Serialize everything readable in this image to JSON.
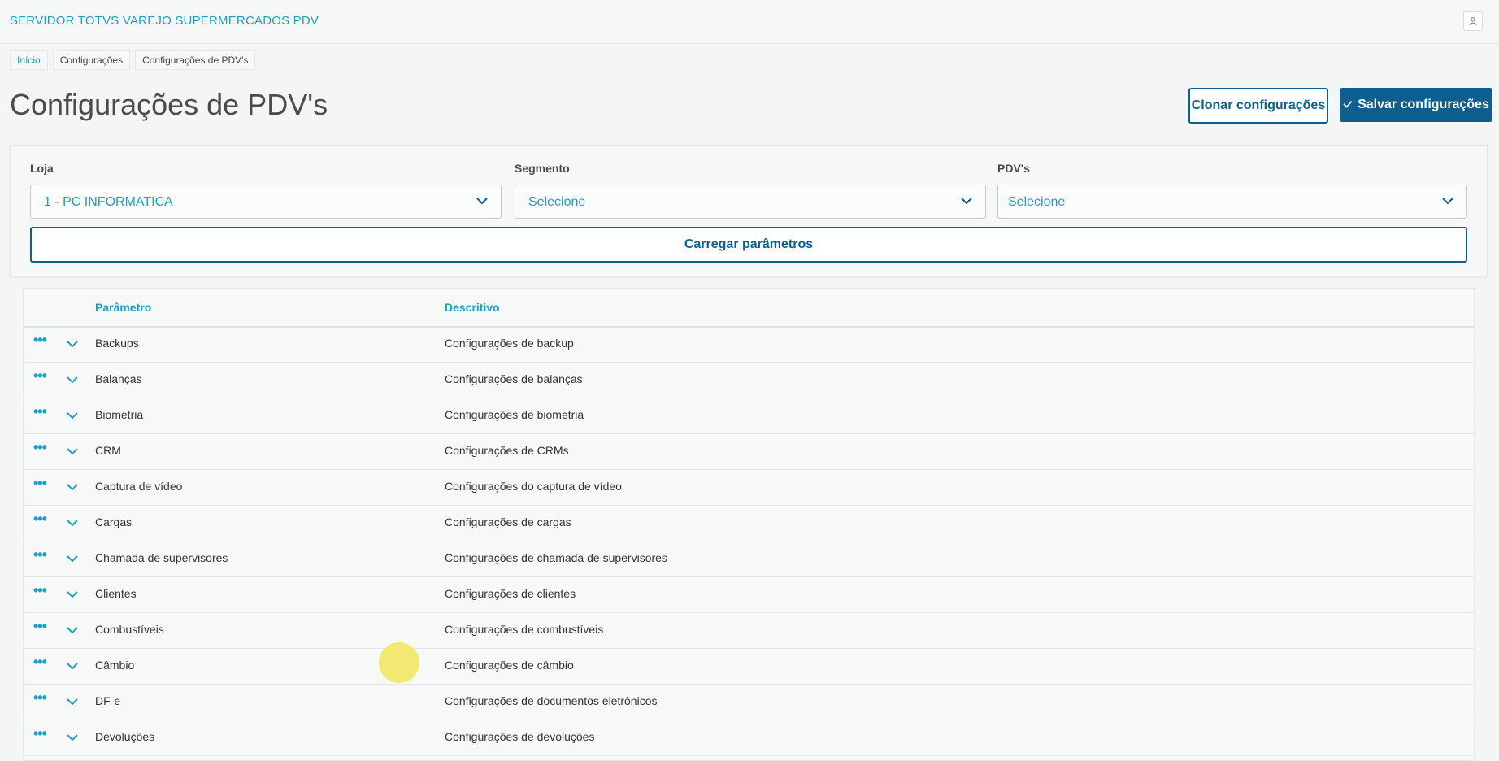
{
  "app": {
    "title": "SERVIDOR TOTVS VAREJO SUPERMERCADOS PDV"
  },
  "breadcrumb": [
    "Início",
    "Configurações",
    "Configurações de PDV's"
  ],
  "page": {
    "title": "Configurações de PDV's"
  },
  "actions": {
    "clone_label": "Clonar configurações",
    "save_label": "Salvar configurações"
  },
  "filters": {
    "loja": {
      "label": "Loja",
      "value": "1 - PC INFORMATICA"
    },
    "segmento": {
      "label": "Segmento",
      "value": "Selecione"
    },
    "pdvs": {
      "label": "PDV's",
      "value": "Selecione"
    },
    "load_label": "Carregar parâmetros"
  },
  "table": {
    "headers": {
      "param": "Parâmetro",
      "desc": "Descritivo"
    },
    "rows": [
      {
        "param": "Backups",
        "desc": "Configurações de backup"
      },
      {
        "param": "Balanças",
        "desc": "Configurações de balanças"
      },
      {
        "param": "Biometria",
        "desc": "Configurações de biometria"
      },
      {
        "param": "CRM",
        "desc": "Configurações de CRMs"
      },
      {
        "param": "Captura de vídeo",
        "desc": "Configurações do captura de vídeo"
      },
      {
        "param": "Cargas",
        "desc": "Configurações de cargas"
      },
      {
        "param": "Chamada de supervisores",
        "desc": "Configurações de chamada de supervisores"
      },
      {
        "param": "Clientes",
        "desc": "Configurações de clientes"
      },
      {
        "param": "Combustíveis",
        "desc": "Configurações de combustíveis"
      },
      {
        "param": "Câmbio",
        "desc": "Configurações de câmbio"
      },
      {
        "param": "DF-e",
        "desc": "Configurações de documentos eletrônicos"
      },
      {
        "param": "Devoluções",
        "desc": "Configurações de devoluções"
      }
    ]
  },
  "colors": {
    "accent": "#1f9fc4",
    "primary": "#0c5f8f"
  }
}
